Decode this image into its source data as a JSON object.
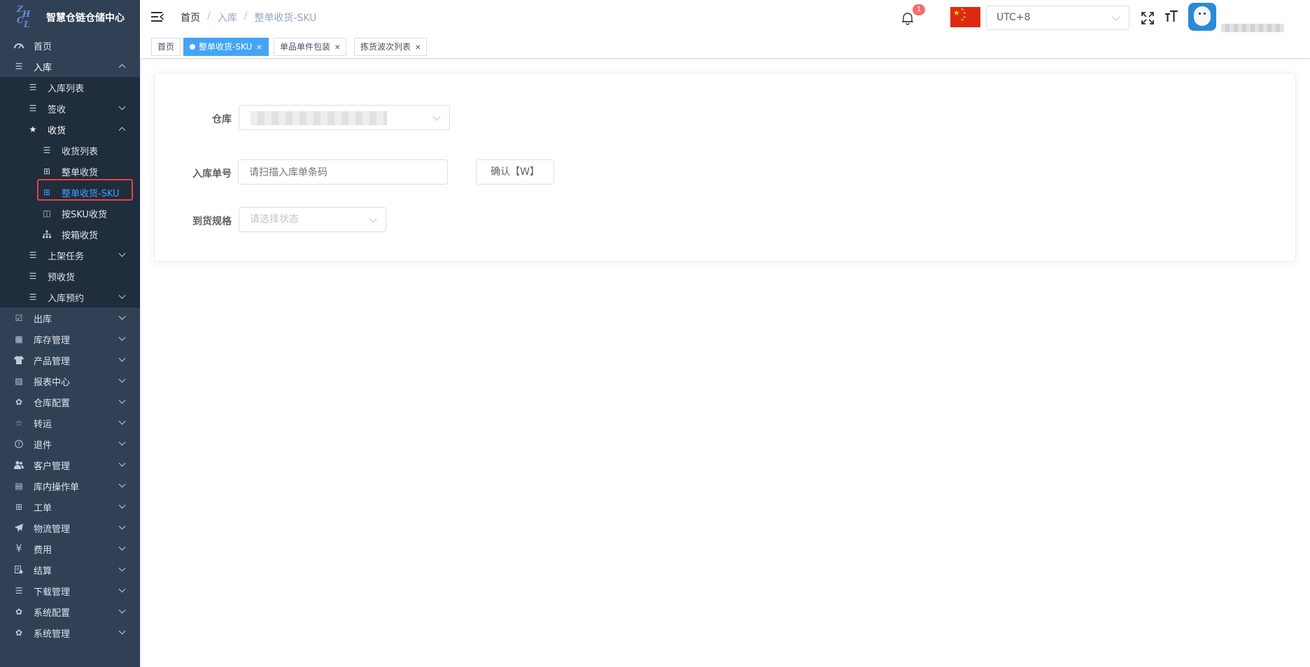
{
  "app": {
    "title": "智慧仓链仓储中心",
    "logo_text": "ZHCL"
  },
  "sidebar": {
    "items": [
      {
        "label": "首页",
        "icon": "dashboard-icon"
      },
      {
        "label": "入库",
        "icon": "list-icon",
        "expanded": true
      },
      {
        "label": "入库列表",
        "icon": "list-icon"
      },
      {
        "label": "签收",
        "icon": "list-icon"
      },
      {
        "label": "收货",
        "icon": "star-icon",
        "expanded": true
      },
      {
        "label": "收货列表",
        "icon": "list-icon"
      },
      {
        "label": "整单收货",
        "icon": "table-icon"
      },
      {
        "label": "整单收货-SKU",
        "icon": "table-icon",
        "selected": true
      },
      {
        "label": "按SKU收货",
        "icon": "column-icon"
      },
      {
        "label": "按箱收货",
        "icon": "tree-icon"
      },
      {
        "label": "上架任务",
        "icon": "list-icon"
      },
      {
        "label": "预收货",
        "icon": "list-icon"
      },
      {
        "label": "入库预约",
        "icon": "list-icon"
      },
      {
        "label": "出库",
        "icon": "checkbox-icon"
      },
      {
        "label": "库存管理",
        "icon": "inventory-icon"
      },
      {
        "label": "产品管理",
        "icon": "shirt-icon"
      },
      {
        "label": "报表中心",
        "icon": "chart-icon"
      },
      {
        "label": "仓库配置",
        "icon": "gear-icon"
      },
      {
        "label": "转运",
        "icon": "star-outline-icon"
      },
      {
        "label": "退件",
        "icon": "question-icon"
      },
      {
        "label": "客户管理",
        "icon": "users-icon"
      },
      {
        "label": "库内操作单",
        "icon": "document-icon"
      },
      {
        "label": "工单",
        "icon": "table-icon"
      },
      {
        "label": "物流管理",
        "icon": "plane-icon"
      },
      {
        "label": "费用",
        "icon": "yen-icon"
      },
      {
        "label": "结算",
        "icon": "settlement-icon"
      },
      {
        "label": "下载管理",
        "icon": "list-icon"
      },
      {
        "label": "系统配置",
        "icon": "gear-icon"
      },
      {
        "label": "系统管理",
        "icon": "gear-icon"
      }
    ]
  },
  "header": {
    "breadcrumb": [
      "首页",
      "入库",
      "整单收货-SKU"
    ],
    "notification_count": "1",
    "timezone": "UTC+8",
    "flag": "china-flag-icon"
  },
  "tags": [
    {
      "label": "首页"
    },
    {
      "label": "整单收货-SKU",
      "active": true
    },
    {
      "label": "单品单件包装"
    },
    {
      "label": "拣货波次列表"
    }
  ],
  "form": {
    "warehouse_label": "仓库",
    "order_label": "入库单号",
    "order_placeholder": "请扫描入库单条码",
    "confirm_label": "确认【W】",
    "spec_label": "到货规格",
    "spec_placeholder": "请选择状态"
  },
  "colors": {
    "sidebar_bg": "#304156",
    "submenu_bg": "#1f2d3d",
    "accent": "#409eff",
    "tag_active": "#42a5f5",
    "badge": "#f56c6c",
    "highlight_box": "#e8433c"
  }
}
